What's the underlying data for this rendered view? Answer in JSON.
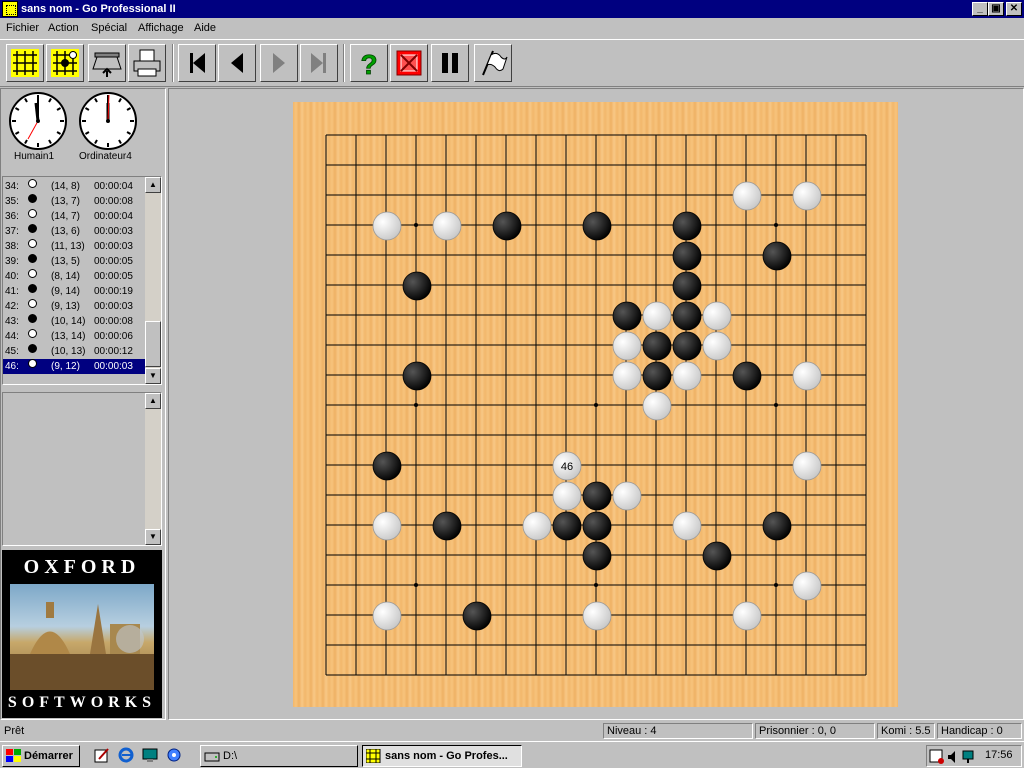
{
  "window": {
    "title": "sans nom - Go Professional II",
    "controls": [
      "_",
      "▣",
      "✕"
    ]
  },
  "menu": [
    "Fichier",
    "Action",
    "Spécial",
    "Affichage",
    "Aide"
  ],
  "toolbar": {
    "buttons": [
      "new-game-icon",
      "setup-board-icon",
      "load-icon",
      "print-icon",
      "first-move-icon",
      "previous-move-icon",
      "next-move-icon",
      "last-move-icon",
      "hint-icon",
      "resign-icon",
      "pause-icon",
      "pass-icon"
    ]
  },
  "clocks": [
    {
      "label": "Humain1"
    },
    {
      "label": "Ordinateur4"
    }
  ],
  "moves": [
    {
      "num": "34:",
      "color": "white",
      "pos": "(14, 8)",
      "time": "00:00:04"
    },
    {
      "num": "35:",
      "color": "black",
      "pos": "(13, 7)",
      "time": "00:00:08"
    },
    {
      "num": "36:",
      "color": "white",
      "pos": "(14, 7)",
      "time": "00:00:04"
    },
    {
      "num": "37:",
      "color": "black",
      "pos": "(13, 6)",
      "time": "00:00:03"
    },
    {
      "num": "38:",
      "color": "white",
      "pos": "(11, 13)",
      "time": "00:00:03"
    },
    {
      "num": "39:",
      "color": "black",
      "pos": "(13, 5)",
      "time": "00:00:05"
    },
    {
      "num": "40:",
      "color": "white",
      "pos": "(8, 14)",
      "time": "00:00:05"
    },
    {
      "num": "41:",
      "color": "black",
      "pos": "(9, 14)",
      "time": "00:00:19"
    },
    {
      "num": "42:",
      "color": "white",
      "pos": "(9, 13)",
      "time": "00:00:03"
    },
    {
      "num": "43:",
      "color": "black",
      "pos": "(10, 14)",
      "time": "00:00:08"
    },
    {
      "num": "44:",
      "color": "white",
      "pos": "(13, 14)",
      "time": "00:00:06"
    },
    {
      "num": "45:",
      "color": "black",
      "pos": "(10, 13)",
      "time": "00:00:12"
    },
    {
      "num": "46:",
      "color": "white",
      "pos": "(9, 12)",
      "time": "00:00:03"
    }
  ],
  "logo": {
    "top": "OXFORD",
    "bottom": "SOFTWORKS"
  },
  "board": {
    "size": 19,
    "last_move_label": "46",
    "black": [
      [
        6,
        3
      ],
      [
        9,
        3
      ],
      [
        12,
        3
      ],
      [
        12,
        4
      ],
      [
        15,
        4
      ],
      [
        12,
        5
      ],
      [
        3,
        5
      ],
      [
        10,
        6
      ],
      [
        12,
        6
      ],
      [
        11,
        7
      ],
      [
        12,
        7
      ],
      [
        3,
        8
      ],
      [
        11,
        8
      ],
      [
        14,
        8
      ],
      [
        2,
        11
      ],
      [
        9,
        12
      ],
      [
        8,
        13
      ],
      [
        9,
        13
      ],
      [
        4,
        13
      ],
      [
        15,
        13
      ],
      [
        9,
        14
      ],
      [
        13,
        14
      ],
      [
        5,
        16
      ]
    ],
    "white": [
      [
        14,
        2
      ],
      [
        16,
        2
      ],
      [
        2,
        3
      ],
      [
        4,
        3
      ],
      [
        11,
        6
      ],
      [
        13,
        6
      ],
      [
        10,
        7
      ],
      [
        13,
        7
      ],
      [
        10,
        8
      ],
      [
        12,
        8
      ],
      [
        16,
        8
      ],
      [
        11,
        9
      ],
      [
        16,
        11
      ],
      [
        8,
        12
      ],
      [
        8,
        12.001
      ],
      [
        10,
        12
      ],
      [
        7,
        13
      ],
      [
        12,
        13
      ],
      [
        2,
        13
      ],
      [
        16,
        15
      ],
      [
        2,
        16
      ],
      [
        9,
        16
      ],
      [
        14,
        16
      ]
    ],
    "hoshi": [
      [
        3,
        3
      ],
      [
        9,
        3
      ],
      [
        15,
        3
      ],
      [
        3,
        9
      ],
      [
        9,
        9
      ],
      [
        15,
        9
      ],
      [
        3,
        15
      ],
      [
        9,
        15
      ],
      [
        15,
        15
      ]
    ]
  },
  "status": {
    "text": "Prêt",
    "level": "Niveau : 4",
    "prisoners": "Prisonnier : 0, 0",
    "komi": "Komi : 5.5",
    "handicap": "Handicap : 0"
  },
  "taskbar": {
    "start": "Démarrer",
    "tasks": [
      "D:\\",
      "sans nom - Go Profes..."
    ],
    "time": "17:56"
  }
}
